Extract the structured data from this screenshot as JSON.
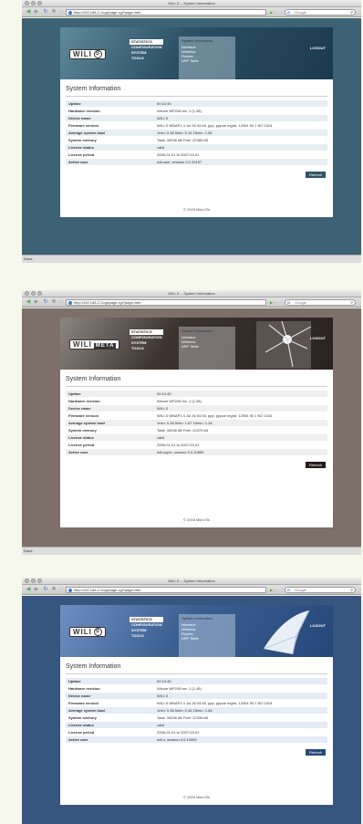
{
  "browser": {
    "window_title": "WILI-S -- System Information",
    "url": "http://192.168.2.1/cgi/page.cgi?page=info",
    "go_label": "▶ ·",
    "search_placeholder": "Google",
    "status": "Done"
  },
  "page": {
    "nav": [
      "STATISTICS",
      "CONFIGURATION",
      "SYSTEM",
      "TOOLS"
    ],
    "subnav_head": "System information",
    "subnav": [
      "Interface",
      "Wireless",
      "Routes",
      "ARP Table"
    ],
    "subnav_short": [
      "Interface",
      "Wireless",
      "ARP Table"
    ],
    "logout": "LOGOUT",
    "title": "System Information",
    "refresh": "Refresh",
    "copyright": "© 2005 MikroTik"
  },
  "logos": {
    "wili": "WILI",
    "wili_e": "S",
    "meta": "META"
  },
  "shots": [
    {
      "theme": "teal",
      "rows": [
        [
          "Uptime",
          "00:10:45"
        ],
        [
          "Hardware revision",
          "Wicom WP245 rev. 1 (1.48)"
        ],
        [
          "Device name",
          "WILI-S"
        ],
        [
          "Firmware version",
          "WILI-S WNAP1.4 Jul 26 04:45, ppp, pppoe mgmt, 12004 90 1 NO 1024"
        ],
        [
          "Average system load",
          "1min: 0.38 5min: 0.14 15min: 1.08"
        ],
        [
          "System memory",
          "Total: 30036 kB Free: 22380 kB"
        ],
        [
          "License status",
          "valid"
        ],
        [
          "License period",
          "2006-01-01 to 2007-03-01"
        ],
        [
          "Active user",
          "wili-user, session 0.0.10197"
        ]
      ]
    },
    {
      "theme": "brown",
      "rows": [
        [
          "Uptime",
          "00:10:45"
        ],
        [
          "Hardware revision",
          "Wicom WP245 rev. 1 (1.48)"
        ],
        [
          "Device name",
          "WILI-S"
        ],
        [
          "Firmware version",
          "WILI-S WNAP1.4 Jul 26 04:45, ppp, pppoe mgmt, 12004 90 1 NO 1024"
        ],
        [
          "Average system load",
          "1min: 0.38 5min: 1.67 15min: 1.18"
        ],
        [
          "System memory",
          "Total: 30036 kB Free: 22370 kB"
        ],
        [
          "License status",
          "valid"
        ],
        [
          "License period",
          "2006-01-01 to 2007-03-01"
        ],
        [
          "Active user",
          "wili-super, session 0.0.10865"
        ]
      ]
    },
    {
      "theme": "blue",
      "rows": [
        [
          "Uptime",
          "00:10:45"
        ],
        [
          "Hardware revision",
          "Wicom WP245 rev. 1 (1.48)"
        ],
        [
          "Device name",
          "WILI-S"
        ],
        [
          "Firmware version",
          "WILI-S WNAP1.4 Jul 26 04:45, ppp, pppoe mgmt, 12004 90 1 NO 1024"
        ],
        [
          "Average system load",
          "1min: 0.38 5min: 0.48 15min: 1.08"
        ],
        [
          "System memory",
          "Total: 30036 kB Free: 22330 kB"
        ],
        [
          "License status",
          "valid"
        ],
        [
          "License period",
          "2006-01-01 to 2007-03-01"
        ],
        [
          "Active user",
          "wili-s, session 0.0.10999"
        ]
      ]
    }
  ]
}
